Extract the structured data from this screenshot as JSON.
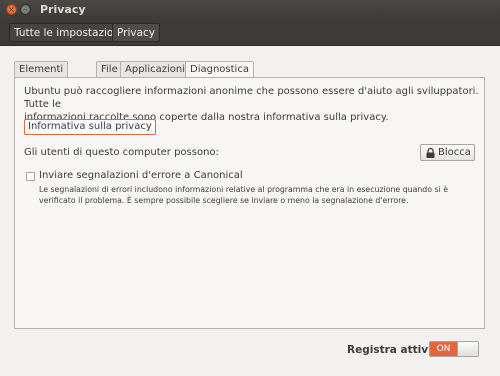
{
  "window": {
    "title": "Privacy",
    "close_glyph": "×",
    "minimize_glyph": "–"
  },
  "toolbar": {
    "breadcrumbs": [
      {
        "label": "Tutte le impostazioni"
      },
      {
        "label": "Privacy"
      }
    ]
  },
  "tabs": [
    {
      "label": "Elementi recenti",
      "active": false
    },
    {
      "label": "File",
      "active": false
    },
    {
      "label": "Applicazioni",
      "active": false
    },
    {
      "label": "Diagnostica",
      "active": true
    }
  ],
  "diagnostics": {
    "description_line1": "Ubuntu può raccogliere informazioni anonime che possono essere d'aiuto agli sviluppatori. Tutte le",
    "description_line2": "informazioni raccolte sono coperte dalla nostra informativa sulla privacy.",
    "privacy_policy_button": "Informativa sulla privacy",
    "users_label": "Gli utenti di questo computer possono:",
    "block_button": "Blocca",
    "block_icon": "lock-icon",
    "error_reports": {
      "label": "Inviare segnalazioni d'errore a Canonical",
      "checked": false,
      "description_line1": "Le segnalazioni di errori includono informazioni relative al programma che era in esecuzione quando si è",
      "description_line2": "verificato il problema. È sempre possibile scegliere se inviare o meno la segnalazione d'errore."
    }
  },
  "footer": {
    "record_activity_label": "Registra attività",
    "switch_state": "ON"
  },
  "colors": {
    "accent": "#e2673b",
    "titlebar": "#3c3b37",
    "background": "#f2f1f0"
  }
}
